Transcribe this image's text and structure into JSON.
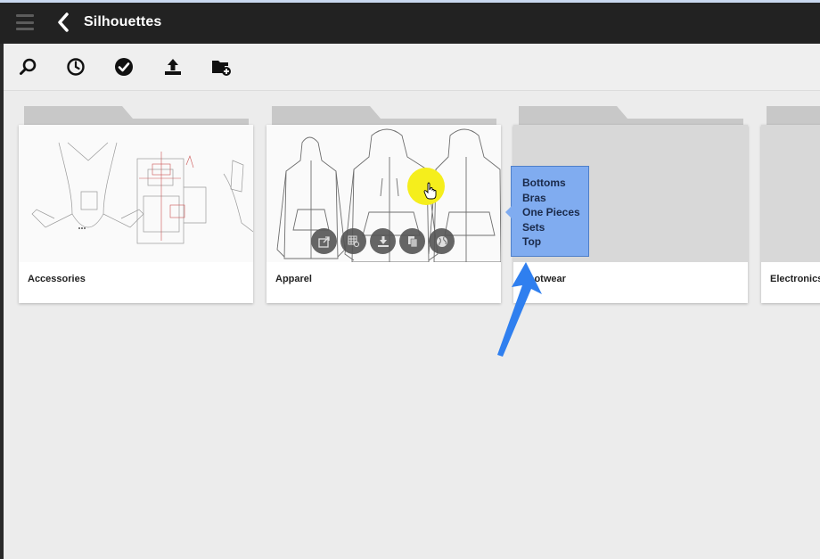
{
  "header": {
    "title": "Silhouettes"
  },
  "toolbar": {
    "icons": [
      "search-icon",
      "clock-icon",
      "check-icon",
      "upload-icon",
      "add-folder-icon"
    ]
  },
  "folders": [
    {
      "label": "Accessories"
    },
    {
      "label": "Apparel"
    },
    {
      "label": "Footwear"
    },
    {
      "label": "Electronics"
    }
  ],
  "overlay_actions": [
    "share-icon",
    "grid-search-icon",
    "download-icon",
    "copy-icon",
    "globe-icon"
  ],
  "popup": {
    "items": [
      "Bottoms",
      "Bras",
      "One Pieces",
      "Sets",
      "Top"
    ]
  },
  "colors": {
    "titlebar": "#222222",
    "popup_bg": "#80acf0",
    "arrow": "#2f7fef",
    "highlight": "#f5ee1c"
  }
}
